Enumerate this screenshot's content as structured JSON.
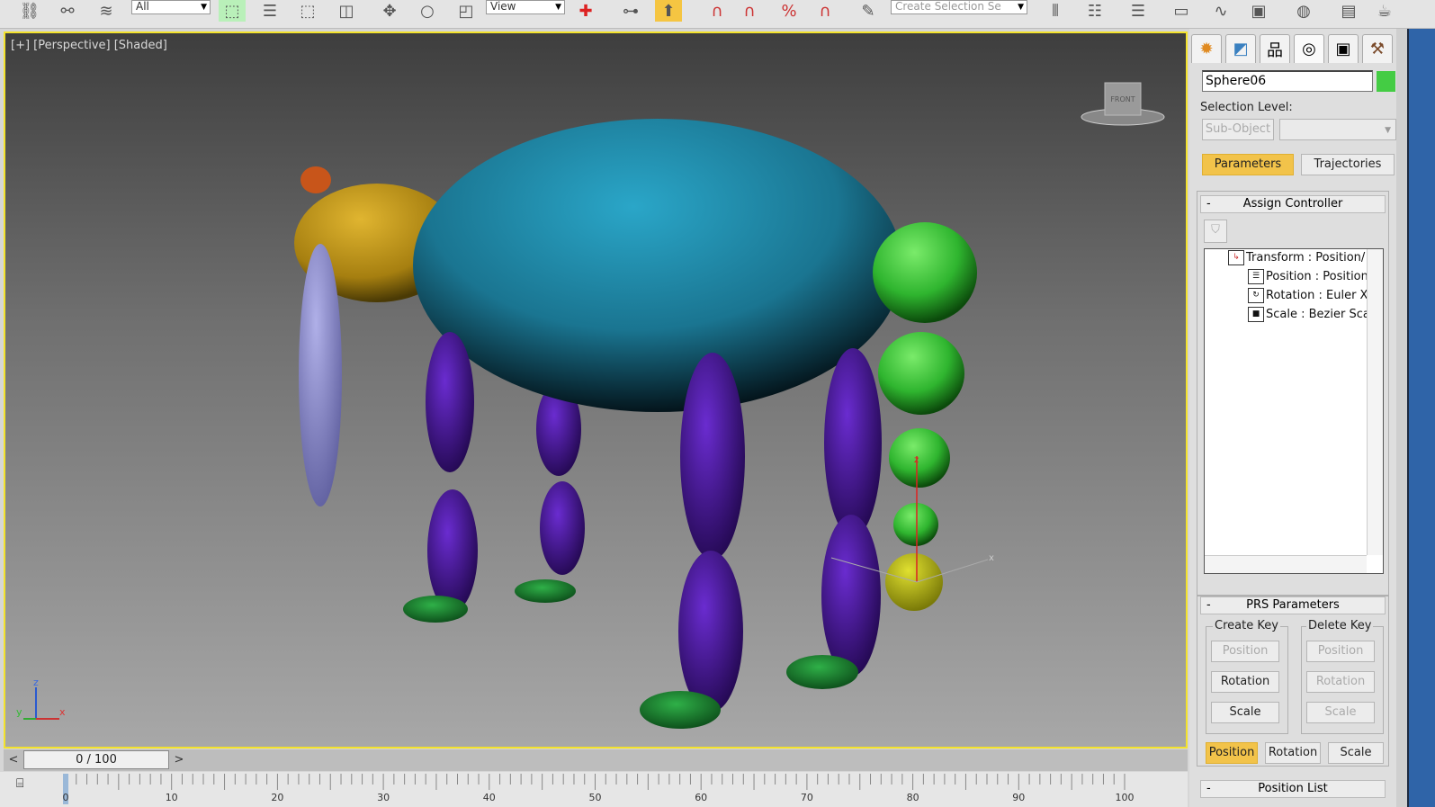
{
  "toolbar": {
    "icons": [
      "link-icon",
      "unlink-icon",
      "bind-spacewarp-icon",
      "select-object-icon",
      "select-by-name-icon",
      "rect-selection-icon",
      "window-crossing-icon",
      "move-icon",
      "rotate-icon",
      "scale-icon",
      "pivot-icon",
      "select-manipulate-icon",
      "keyboard-shortcut-icon",
      "snaps-icon",
      "angle-snap-icon",
      "percent-snap-icon",
      "spinner-snap-icon",
      "edit-named-selection-icon",
      "mirror-icon",
      "align-icon",
      "layer-explorer-icon",
      "scene-explorer-icon",
      "curve-editor-icon",
      "schematic-view-icon",
      "material-editor-icon",
      "render-setup-icon",
      "render-icon"
    ],
    "selection_filter": "All",
    "reference_coord": "View",
    "named_selection_placeholder": "Create Selection Se"
  },
  "viewport": {
    "label": "[+] [Perspective] [Shaded]",
    "border_color": "#f3e22c",
    "viewcube_label": "FRONT",
    "axis_labels": {
      "x": "x",
      "y": "y",
      "z": "z"
    }
  },
  "timeline": {
    "prev": "<",
    "next": ">",
    "slider": "0 / 100",
    "current": 0,
    "end": 100,
    "ticks": [
      "0",
      "10",
      "20",
      "30",
      "40",
      "50",
      "60",
      "70",
      "80",
      "90",
      "100"
    ]
  },
  "command_panel": {
    "tabs": [
      "create",
      "modify",
      "hierarchy",
      "motion",
      "display",
      "utilities"
    ],
    "active_tab": "motion",
    "object_name": "Sphere06",
    "object_color": "#44cc44",
    "selection_level_label": "Selection Level:",
    "sub_object": "Sub-Object",
    "parameters": "Parameters",
    "trajectories": "Trajectories",
    "assign_controller": {
      "title": "Assign Controller",
      "tree": [
        "Transform : Position/",
        "Position : Position",
        "Rotation : Euler X",
        "Scale : Bezier Sca"
      ]
    },
    "prs": {
      "title": "PRS Parameters",
      "create_key": "Create Key",
      "delete_key": "Delete Key",
      "position": "Position",
      "rotation": "Rotation",
      "scale": "Scale"
    },
    "position_list": "Position List"
  },
  "colors": {
    "accent": "#f2c34a",
    "body": "#1e7f9a",
    "head": "#c79a18",
    "legs": "#4a1aa0",
    "feet": "#1f8a35",
    "spheres": "#3cc43c"
  }
}
